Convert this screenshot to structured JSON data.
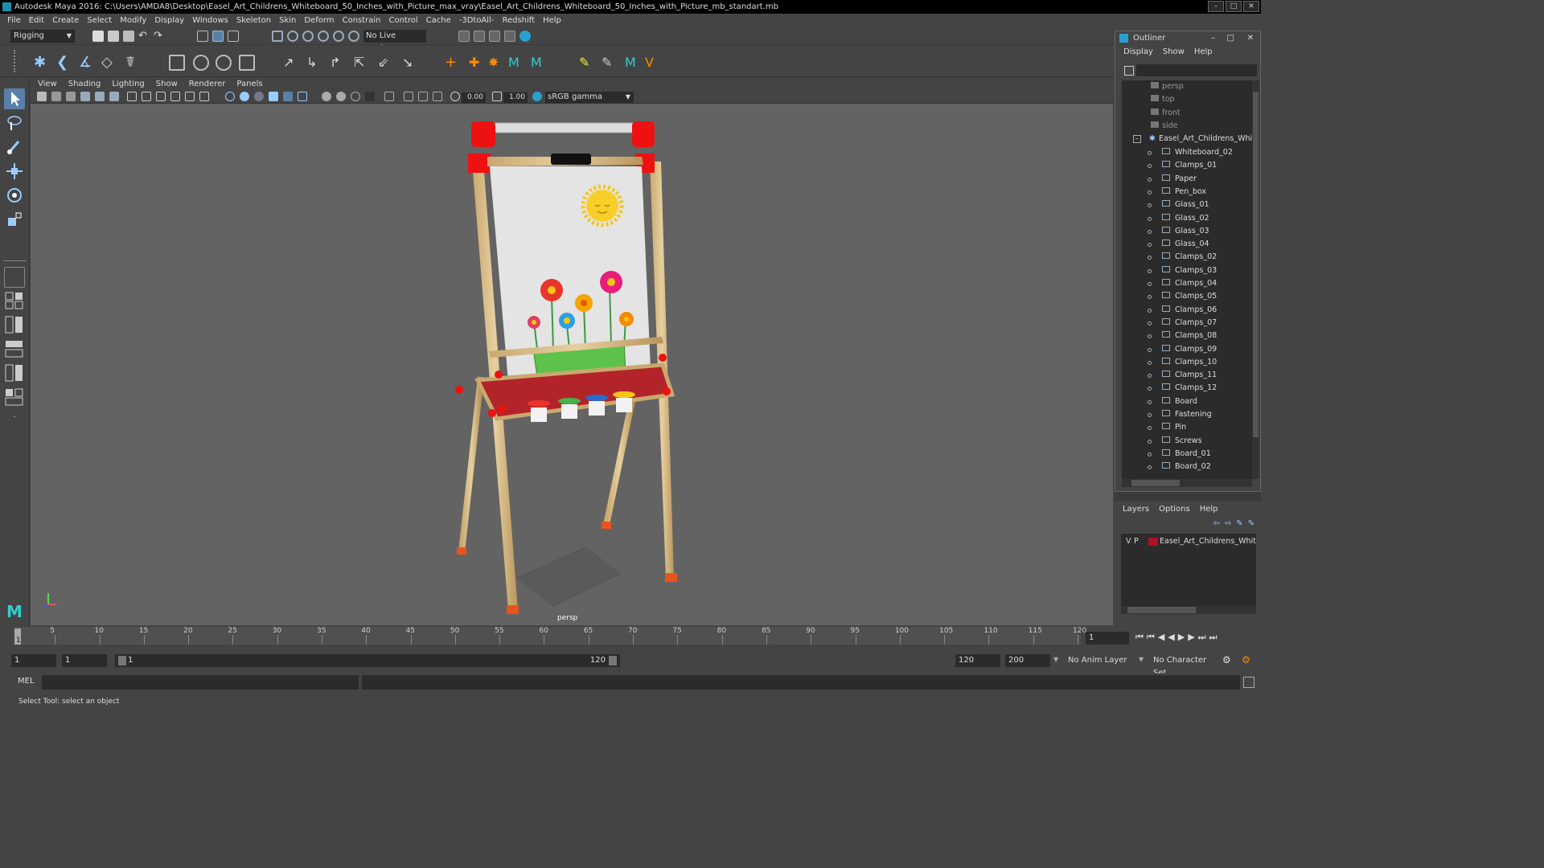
{
  "title_bar": {
    "text": "Autodesk Maya 2016: C:\\Users\\AMDA8\\Desktop\\Easel_Art_Childrens_Whiteboard_50_Inches_with_Picture_max_vray\\Easel_Art_Childrens_Whiteboard_50_Inches_with_Picture_mb_standart.mb"
  },
  "menu": [
    "File",
    "Edit",
    "Create",
    "Select",
    "Modify",
    "Display",
    "Windows",
    "Skeleton",
    "Skin",
    "Deform",
    "Constrain",
    "Control",
    "Cache",
    "-3DtoAll-",
    "Redshift",
    "Help"
  ],
  "shelf": {
    "mode": "Rigging",
    "live_surface": "No Live Surface"
  },
  "viewport": {
    "menu": [
      "View",
      "Shading",
      "Lighting",
      "Show",
      "Renderer",
      "Panels"
    ],
    "near_value": "0.00",
    "far_value": "1.00",
    "color_space": "sRGB gamma",
    "camera_label": "persp"
  },
  "outliner": {
    "title": "Outliner",
    "menu": [
      "Display",
      "Show",
      "Help"
    ],
    "cameras": [
      "persp",
      "top",
      "front",
      "side"
    ],
    "group": "Easel_Art_Childrens_White",
    "children": [
      "Whiteboard_02",
      "Clamps_01",
      "Paper",
      "Pen_box",
      "Glass_01",
      "Glass_02",
      "Glass_03",
      "Glass_04",
      "Clamps_02",
      "Clamps_03",
      "Clamps_04",
      "Clamps_05",
      "Clamps_06",
      "Clamps_07",
      "Clamps_08",
      "Clamps_09",
      "Clamps_10",
      "Clamps_11",
      "Clamps_12",
      "Board",
      "Fastening",
      "Pin",
      "Screws",
      "Board_01",
      "Board_02"
    ]
  },
  "layers": {
    "menu": [
      "Layers",
      "Options",
      "Help"
    ],
    "layer": {
      "v": "V",
      "p": "P",
      "name": "Easel_Art_Childrens_Whitebc",
      "color": "#b0102a"
    }
  },
  "timeline": {
    "ticks": [
      "5",
      "10",
      "15",
      "20",
      "25",
      "30",
      "35",
      "40",
      "45",
      "50",
      "55",
      "60",
      "65",
      "70",
      "75",
      "80",
      "85",
      "90",
      "95",
      "100",
      "105",
      "110",
      "115",
      "120"
    ],
    "current_frame": "1",
    "current_label": "1"
  },
  "range": {
    "start": "1",
    "anim_start": "1",
    "slider_start": "1",
    "slider_end": "120",
    "anim_end": "120",
    "end": "200",
    "anim_layer": "No Anim Layer",
    "char_set": "No Character Set"
  },
  "command": {
    "label": "MEL"
  },
  "status": {
    "text": "Select Tool: select an object"
  }
}
